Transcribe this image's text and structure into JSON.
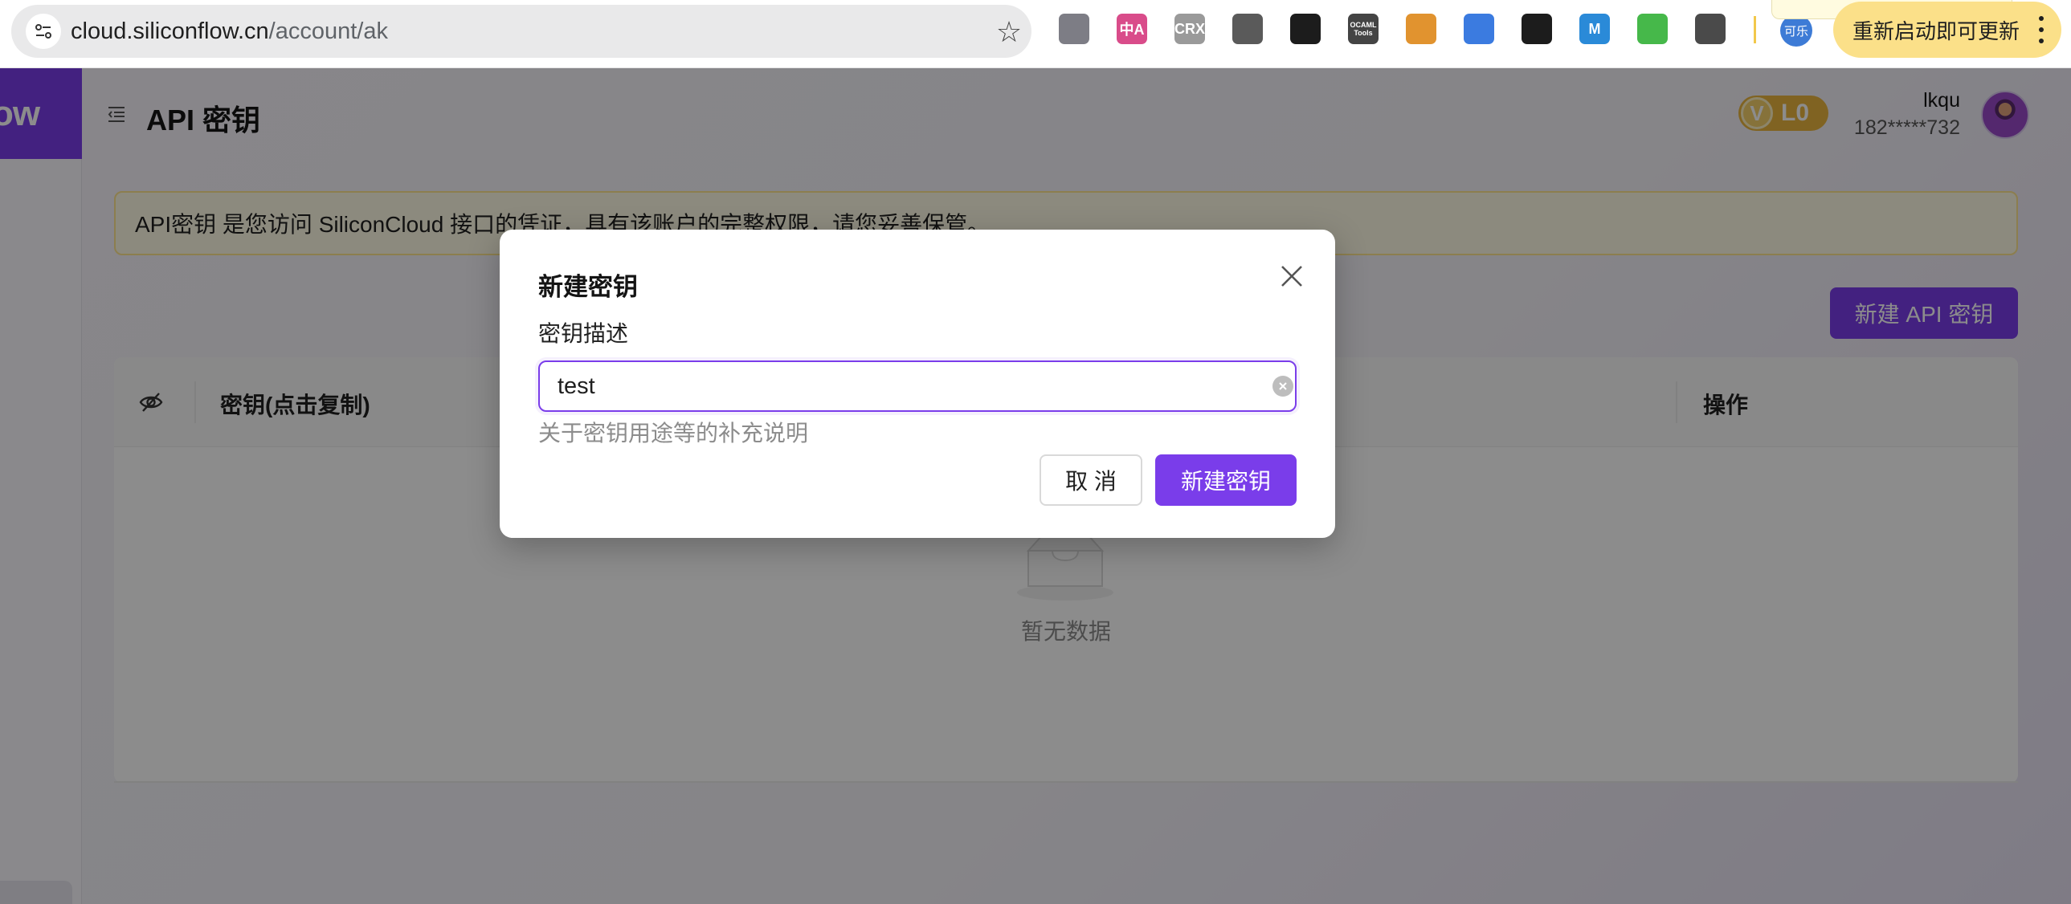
{
  "browser": {
    "url_host": "cloud.siliconflow.cn",
    "url_path": "/account/ak",
    "extensions": [
      {
        "name": "ext-glasses-icon",
        "text": "",
        "color": "#7d7d85"
      },
      {
        "name": "ext-translate-icon",
        "text": "中A",
        "color": "#d94c8a"
      },
      {
        "name": "ext-crx-icon",
        "text": "CRX",
        "color": "#9a9a9a"
      },
      {
        "name": "ext-copy-icon",
        "text": "",
        "color": "#5a5a5a"
      },
      {
        "name": "ext-mouse-icon",
        "text": "",
        "color": "#1c1c1c"
      },
      {
        "name": "ext-ocaml-tools-icon",
        "text": "OCAML Tools",
        "color": "#444444"
      },
      {
        "name": "ext-shiba-icon",
        "text": "",
        "color": "#e1932f"
      },
      {
        "name": "ext-puzzle-blue-icon",
        "text": "",
        "color": "#3b7be0"
      },
      {
        "name": "ext-triangle-icon",
        "text": "",
        "color": "#1c1c1c"
      },
      {
        "name": "ext-m-icon",
        "text": "M",
        "color": "#2a8ad8"
      },
      {
        "name": "ext-check-icon",
        "text": "",
        "color": "#46b84a"
      },
      {
        "name": "ext-puzzle-icon",
        "text": "",
        "color": "#4a4a4a"
      }
    ],
    "profile_label": "可乐",
    "update_label": "重新启动即可更新"
  },
  "app": {
    "logo_text": "ow",
    "page_title": "API 密钥",
    "level_badge": {
      "icon": "V",
      "label": "L0"
    },
    "user": {
      "name": "lkqu",
      "phone": "182*****732"
    },
    "notice": "API密钥 是您访问 SiliconCloud 接口的凭证，具有该账户的完整权限，请您妥善保管。",
    "new_key_button": "新建 API 密钥",
    "table": {
      "columns": [
        "密钥(点击复制)",
        "操作"
      ],
      "empty_text": "暂无数据"
    }
  },
  "modal": {
    "title": "新建密钥",
    "field_label": "密钥描述",
    "field_value": "test",
    "field_help": "关于密钥用途等的补充说明",
    "cancel_label": "取 消",
    "confirm_label": "新建密钥"
  }
}
